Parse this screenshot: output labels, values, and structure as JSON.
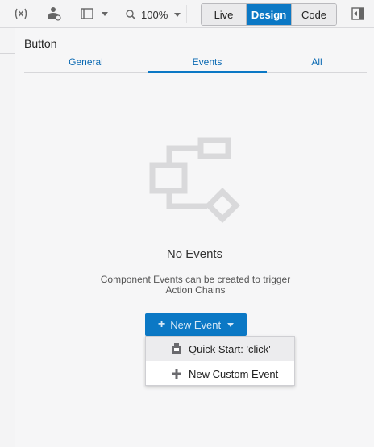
{
  "toolbar": {
    "zoom_value": "100%",
    "modes": [
      {
        "label": "Live",
        "active": false
      },
      {
        "label": "Design",
        "active": true
      },
      {
        "label": "Code",
        "active": false
      }
    ],
    "icons": [
      "variables-icon",
      "user-role-icon",
      "device-frame-icon",
      "zoom-icon",
      "collapse-panel-icon"
    ]
  },
  "panel": {
    "title": "Button",
    "tabs": [
      {
        "label": "General",
        "active": false
      },
      {
        "label": "Events",
        "active": true
      },
      {
        "label": "All",
        "active": false
      }
    ],
    "empty_state": {
      "illustration": "flow-diagram-icon",
      "title": "No Events",
      "description": "Component Events can be created to trigger Action Chains"
    },
    "new_event_button": {
      "label": "New Event"
    },
    "dropdown": {
      "items": [
        {
          "label": "Quick Start: 'click'",
          "icon": "quick-start-icon",
          "hovered": true
        },
        {
          "label": "New Custom Event",
          "icon": "plus-icon",
          "hovered": false
        }
      ]
    }
  },
  "colors": {
    "accent": "#0b78c5",
    "link": "#0b6ab3",
    "background": "#f6f6f7",
    "illustration": "#d9d9db"
  }
}
